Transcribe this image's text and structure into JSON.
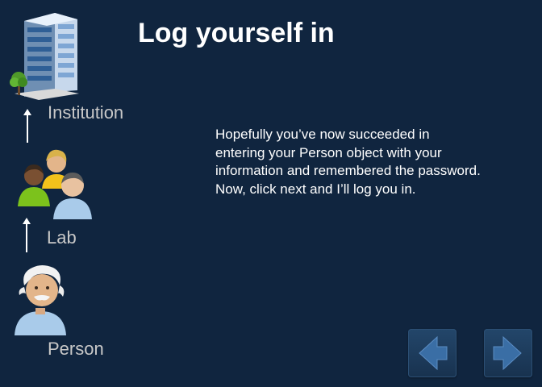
{
  "slide": {
    "title": "Log yourself in",
    "body": "Hopefully you’ve now succeeded in entering your Person object with your information and remembered the password.  Now, click next and I’ll log you in."
  },
  "hierarchy": {
    "levels": [
      {
        "label": "Institution",
        "icon": "building-icon"
      },
      {
        "label": "Lab",
        "icon": "people-group-icon"
      },
      {
        "label": "Person",
        "icon": "scientist-icon"
      }
    ]
  },
  "navigation": {
    "back_icon": "arrow-left-icon",
    "next_icon": "arrow-right-icon"
  },
  "colors": {
    "background": "#10253f",
    "title": "#ffffff",
    "label": "#c8c8c8",
    "button": "#1e3d5e"
  }
}
